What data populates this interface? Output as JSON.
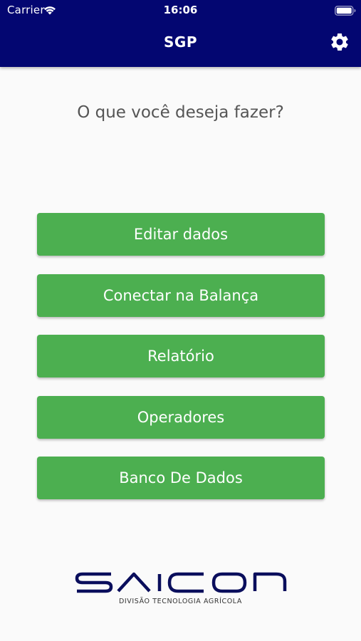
{
  "status_bar": {
    "carrier": "Carrier",
    "time": "16:06",
    "icons": [
      "wifi-icon",
      "battery-icon"
    ]
  },
  "header": {
    "title": "SGP",
    "background_color": "#030671",
    "settings_icon": "gear-icon"
  },
  "main": {
    "prompt": "O que você deseja fazer?",
    "button_color": "#4caf50",
    "actions": [
      {
        "label": "Editar dados"
      },
      {
        "label": "Conectar na Balança"
      },
      {
        "label": "Relatório"
      },
      {
        "label": "Operadores"
      },
      {
        "label": "Banco De Dados"
      }
    ]
  },
  "footer": {
    "logo_text": "SAICON",
    "tagline": "DIVISÃO TECNOLOGIA AGRÍCOLA",
    "logo_color": "#0a0e5c"
  }
}
